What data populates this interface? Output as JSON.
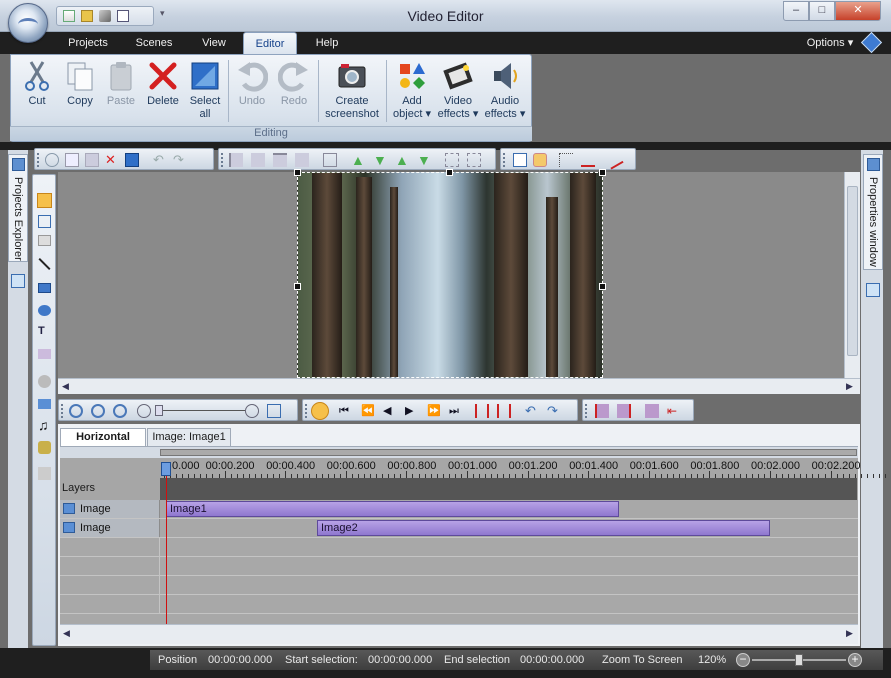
{
  "window": {
    "title": "Video Editor",
    "min_label": "–",
    "max_label": "□",
    "close_label": "✕"
  },
  "ribbon_tabs": [
    {
      "label": "Projects"
    },
    {
      "label": "Scenes"
    },
    {
      "label": "View"
    },
    {
      "label": "Editor"
    },
    {
      "label": "Help"
    }
  ],
  "options_label": "Options",
  "ribbon": {
    "group_label": "Editing",
    "buttons": {
      "cut": "Cut",
      "copy": "Copy",
      "paste": "Paste",
      "delete": "Delete",
      "select_all_1": "Select",
      "select_all_2": "all",
      "undo": "Undo",
      "redo": "Redo",
      "screenshot_1": "Create",
      "screenshot_2": "screenshot",
      "add_object_1": "Add",
      "add_object_2": "object",
      "video_effects_1": "Video",
      "video_effects_2": "effects",
      "audio_effects_1": "Audio",
      "audio_effects_2": "effects"
    }
  },
  "panels": {
    "left": "Projects Explorer",
    "right": "Properties window"
  },
  "timeline": {
    "tabs": [
      "Horizontal",
      "Image: Image1"
    ],
    "layers_label": "Layers",
    "ticks": [
      "0.000",
      "00:00.200",
      "00:00.400",
      "00:00.600",
      "00:00.800",
      "00:01.000",
      "00:01.200",
      "00:01.400",
      "00:01.600",
      "00:01.800",
      "00:02.000",
      "00:02.200"
    ],
    "rows": [
      {
        "label": "Image",
        "clip": "Image1",
        "start": 0.0,
        "end": 1.5
      },
      {
        "label": "Image",
        "clip": "Image2",
        "start": 0.5,
        "end": 2.0
      }
    ]
  },
  "status": {
    "position_label": "Position",
    "position_value": "00:00:00.000",
    "start_label": "Start selection:",
    "start_value": "00:00:00.000",
    "end_label": "End selection",
    "end_value": "00:00:00.000",
    "zoom_label": "Zoom To Screen",
    "zoom_value": "120%"
  },
  "colors": {
    "accent": "#15428b",
    "clip": "#a28ad8",
    "playhead": "#d01010"
  }
}
